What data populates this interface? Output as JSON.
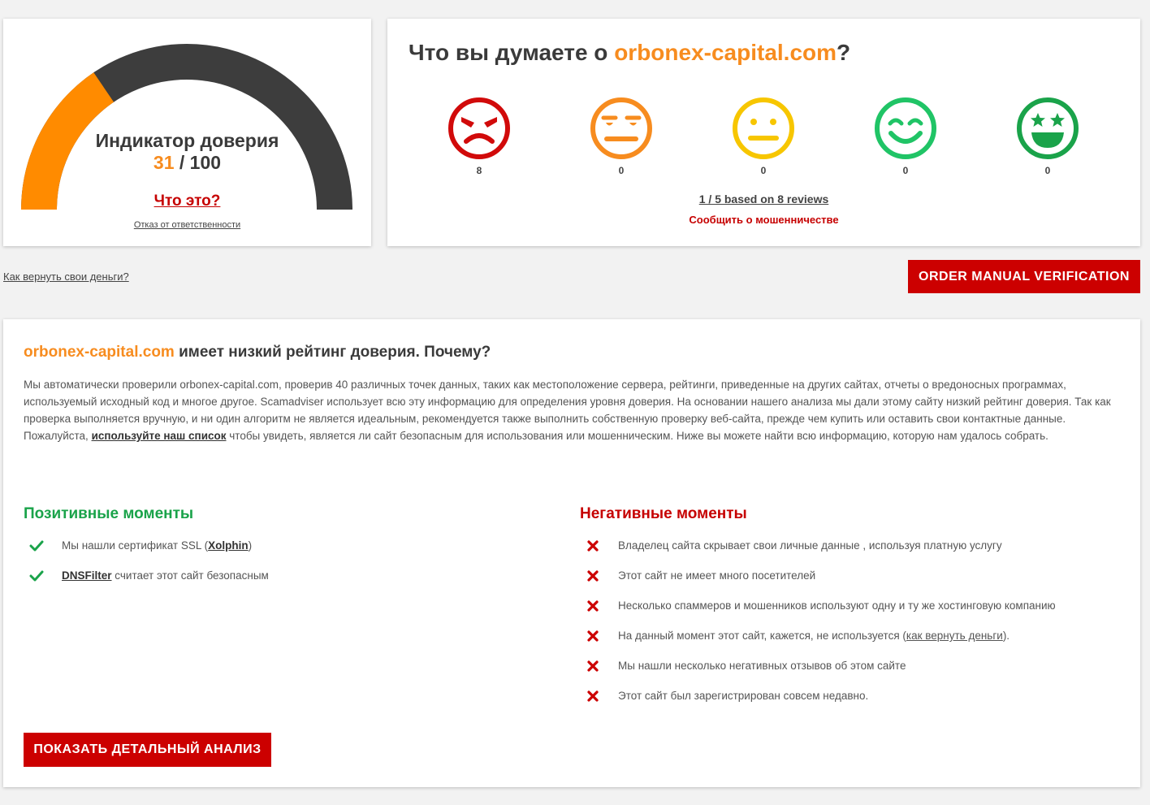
{
  "trust": {
    "title": "Индикатор доверия",
    "score": "31",
    "score_max": "/ 100",
    "score_fraction": 0.31,
    "what_is": "Что это?",
    "disclaimer": "Отказ от ответственности"
  },
  "reviews": {
    "title_prefix": "Что вы думаете о ",
    "domain": "orbonex-capital.com",
    "title_suffix": "?",
    "emojis": [
      {
        "icon": "angry-face-icon",
        "count": "8",
        "color": "#d10a0a"
      },
      {
        "icon": "annoyed-face-icon",
        "count": "0",
        "color": "#f78c1f"
      },
      {
        "icon": "neutral-face-icon",
        "count": "0",
        "color": "#f7c600"
      },
      {
        "icon": "smiling-face-icon",
        "count": "0",
        "color": "#20c466"
      },
      {
        "icon": "star-eyes-face-icon",
        "count": "0",
        "color": "#1aa34a"
      }
    ],
    "based_on": "1 / 5 based on 8 reviews",
    "report": "Сообщить о мошенничестве"
  },
  "money_link": "Как вернуть свои деньги?",
  "order_button": "ORDER MANUAL VERIFICATION",
  "analysis": {
    "domain": "orbonex-capital.com",
    "title_rest": " имеет низкий рейтинг доверия. Почему?",
    "text_before": "Мы автоматически проверили orbonex-capital.com, проверив 40 различных точек данных, таких как местоположение сервера, рейтинги, приведенные на других сайтах, отчеты о вредоносных программах, используемый исходный код и многое другое. Scamadviser использует всю эту информацию для определения уровня доверия. На основании нашего анализа мы дали этому сайту низкий рейтинг доверия. Так как проверка выполняется вручную, и ни один алгоритм не является идеальным, рекомендуется также выполнить собственную проверку веб-сайта, прежде чем купить или оставить свои контактные данные. Пожалуйста, ",
    "text_link": "используйте наш список",
    "text_after": " чтобы увидеть, является ли сайт безопасным для использования или мошенническим. Ниже вы можете найти всю информацию, которую нам удалось собрать.",
    "positive_title": "Позитивные моменты",
    "positive": [
      {
        "before": "Мы нашли сертификат SSL (",
        "link": "Xolphin",
        "after": ")"
      },
      {
        "before": "",
        "link": "DNSFilter",
        "after": " считает этот сайт безопасным"
      }
    ],
    "negative_title": "Негативные моменты",
    "negative": [
      {
        "before": "Владелец сайта скрывает свои личные данные , используя платную услугу",
        "link": "",
        "after": ""
      },
      {
        "before": "Этот сайт не имеет много посетителей",
        "link": "",
        "after": ""
      },
      {
        "before": "Несколько спаммеров и мошенников используют одну и ту же хостинговую компанию",
        "link": "",
        "after": ""
      },
      {
        "before": "На данный момент этот сайт, кажется, не используется (",
        "link": "как вернуть деньги",
        "after": ")."
      },
      {
        "before": "Мы нашли несколько негативных отзывов об этом сайте",
        "link": "",
        "after": ""
      },
      {
        "before": "Этот сайт был зарегистрирован совсем недавно.",
        "link": "",
        "after": ""
      }
    ],
    "detail_button": "ПОКАЗАТЬ ДЕТАЛЬНЫЙ АНАЛИЗ"
  },
  "colors": {
    "accent_orange": "#f78c1f",
    "danger_red": "#cc0000",
    "positive_green": "#1aa34a",
    "gauge_track": "#3d3d3d"
  }
}
